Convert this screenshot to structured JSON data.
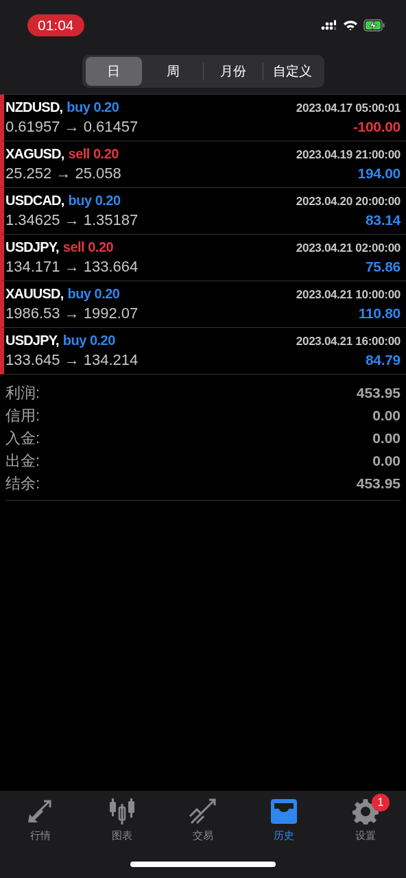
{
  "status_bar": {
    "time": "01:04"
  },
  "tabs": [
    {
      "label": "日",
      "selected": true
    },
    {
      "label": "周",
      "selected": false
    },
    {
      "label": "月份",
      "selected": false
    },
    {
      "label": "自定义",
      "selected": false
    }
  ],
  "trades": [
    {
      "symbol": "NZDUSD,",
      "kind": "buy",
      "side": "buy",
      "volume": "0.20",
      "time": "2023.04.17 05:00:01",
      "prices": "0.61957 → 0.61457",
      "profit": "-100.00",
      "loss": true
    },
    {
      "symbol": "XAGUSD,",
      "kind": "sell",
      "side": "sell",
      "volume": "0.20",
      "time": "2023.04.19 21:00:00",
      "prices": "25.252 → 25.058",
      "profit": "194.00",
      "loss": false
    },
    {
      "symbol": "USDCAD,",
      "kind": "buy",
      "side": "buy",
      "volume": "0.20",
      "time": "2023.04.20 20:00:00",
      "prices": "1.34625 → 1.35187",
      "profit": "83.14",
      "loss": false
    },
    {
      "symbol": "USDJPY,",
      "kind": "sell",
      "side": "sell",
      "volume": "0.20",
      "time": "2023.04.21 02:00:00",
      "prices": "134.171 → 133.664",
      "profit": "75.86",
      "loss": false
    },
    {
      "symbol": "XAUUSD,",
      "kind": "buy",
      "side": "buy",
      "volume": "0.20",
      "time": "2023.04.21 10:00:00",
      "prices": "1986.53 → 1992.07",
      "profit": "110.80",
      "loss": false
    },
    {
      "symbol": "USDJPY,",
      "kind": "buy",
      "side": "buy",
      "volume": "0.20",
      "time": "2023.04.21 16:00:00",
      "prices": "133.645 → 134.214",
      "profit": "84.79",
      "loss": false
    }
  ],
  "summary": [
    {
      "label": "利润:",
      "value": "453.95"
    },
    {
      "label": "信用:",
      "value": "0.00"
    },
    {
      "label": "入金:",
      "value": "0.00"
    },
    {
      "label": "出金:",
      "value": "0.00"
    },
    {
      "label": "结余:",
      "value": "453.95"
    }
  ],
  "nav": [
    {
      "kind": "quotes",
      "label": "行情",
      "selected": false
    },
    {
      "kind": "chart",
      "label": "图表",
      "selected": false
    },
    {
      "kind": "trade",
      "label": "交易",
      "selected": false
    },
    {
      "kind": "history",
      "label": "历史",
      "selected": true
    },
    {
      "kind": "settings",
      "label": "设置",
      "selected": false,
      "badge": "1"
    }
  ]
}
